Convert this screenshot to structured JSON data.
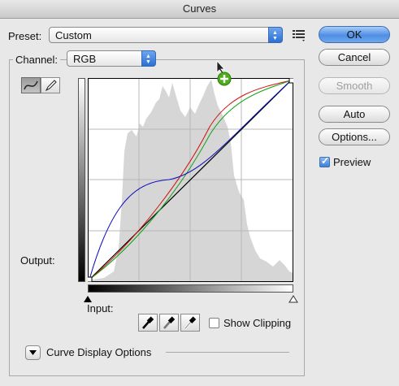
{
  "window": {
    "title": "Curves"
  },
  "preset": {
    "label": "Preset:",
    "value": "Custom"
  },
  "channel": {
    "label": "Channel:",
    "value": "RGB"
  },
  "buttons": {
    "ok": "OK",
    "cancel": "Cancel",
    "smooth": "Smooth",
    "auto": "Auto",
    "options": "Options..."
  },
  "preview": {
    "label": "Preview",
    "checked": true
  },
  "graph": {
    "output_label": "Output:",
    "input_label": "Input:"
  },
  "show_clipping": {
    "label": "Show Clipping",
    "checked": false
  },
  "curve_display": {
    "label": "Curve Display Options"
  },
  "colors": {
    "accent": "#3d7fdb",
    "red_curve": "#d01010",
    "green_curve": "#10a010",
    "blue_curve": "#1010c0",
    "rgb_curve": "#000000",
    "histogram": "#d6d6d6",
    "add_point": "#4caf1a"
  },
  "icons": [
    "curve-tool-icon",
    "pencil-icon",
    "preset-options-icon",
    "black-point-eyedropper-icon",
    "gray-point-eyedropper-icon",
    "white-point-eyedropper-icon",
    "add-point-cursor-icon",
    "disclosure-triangle-icon"
  ]
}
